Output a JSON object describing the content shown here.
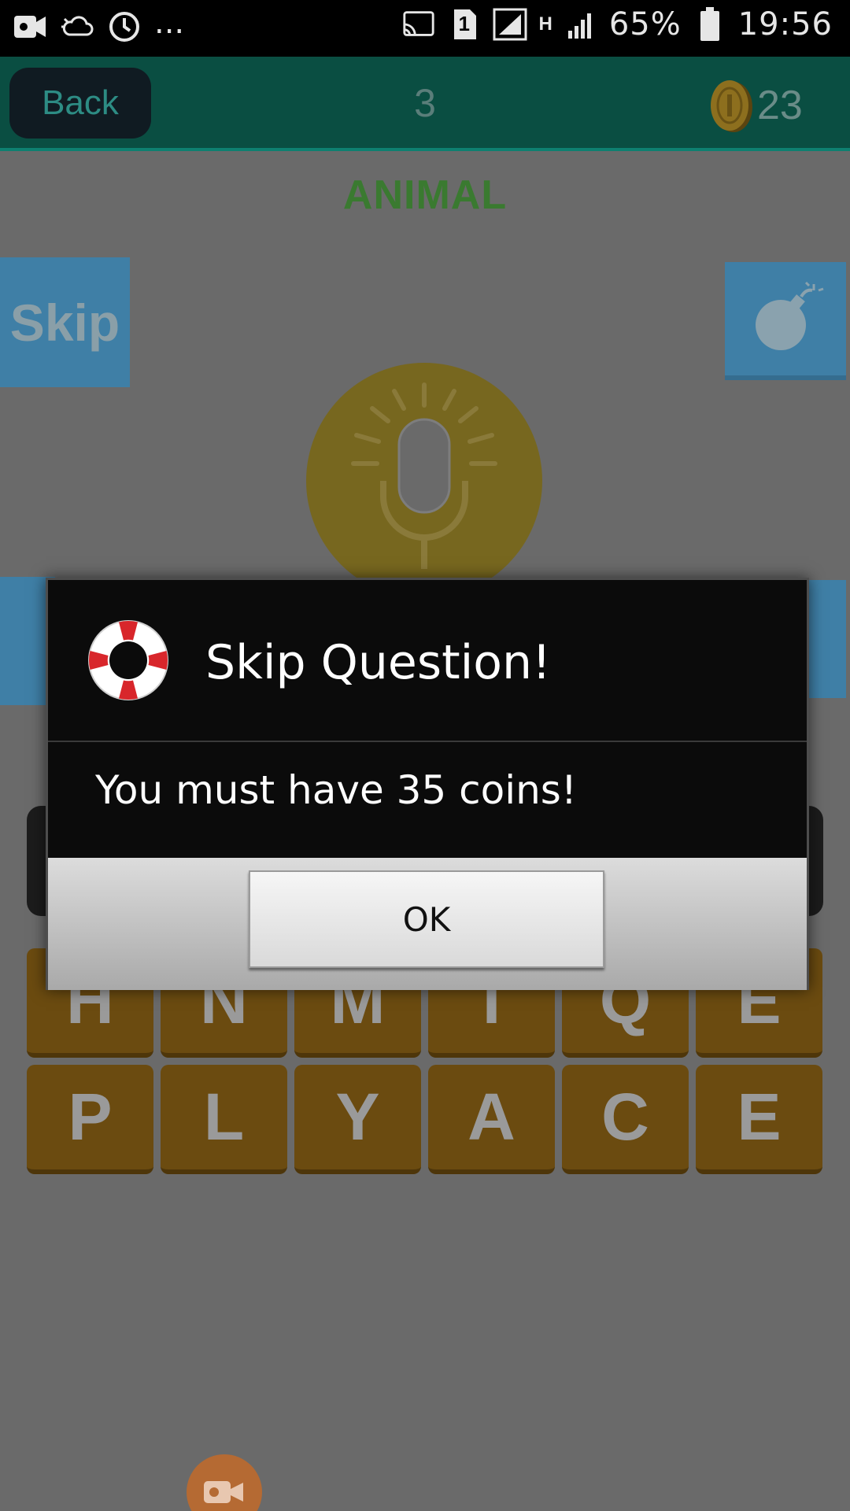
{
  "status_bar": {
    "battery_percent": "65%",
    "time": "19:56",
    "sim_slot": "1",
    "network_type": "H",
    "more": "...",
    "icons": [
      "video-camera-icon",
      "weather-icon",
      "sync-icon",
      "cast-icon",
      "sim-icon",
      "signal-icon",
      "data-icon",
      "battery-icon"
    ]
  },
  "header": {
    "back_label": "Back",
    "level": "3",
    "coins": "23"
  },
  "game": {
    "category": "ANIMAL",
    "skip_label": "Skip",
    "letters": [
      "H",
      "N",
      "M",
      "I",
      "Q",
      "E",
      "P",
      "L",
      "Y",
      "A",
      "C",
      "E"
    ]
  },
  "dialog": {
    "title": "Skip Question!",
    "message": "You must have 35 coins!",
    "ok_label": "OK"
  },
  "colors": {
    "header_bg": "#0a4e42",
    "tile_blue": "#3f7fa6",
    "letter_gold": "#6b4b10",
    "category_green": "#3a7a30"
  }
}
